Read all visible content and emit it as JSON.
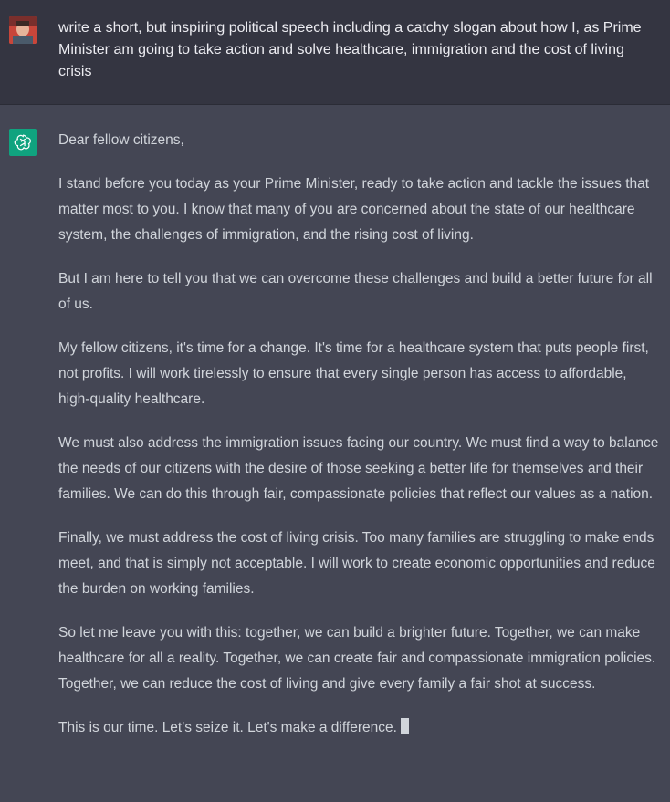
{
  "user_message": {
    "avatar_icon": "user-photo-icon",
    "text": "write a short, but inspiring political speech including a catchy slogan about how I, as Prime Minister am going to take action and solve healthcare, immigration and the cost of living crisis"
  },
  "assistant_message": {
    "avatar_icon": "openai-logo-icon",
    "paragraphs": [
      "Dear fellow citizens,",
      "I stand before you today as your Prime Minister, ready to take action and tackle the issues that matter most to you. I know that many of you are concerned about the state of our healthcare system, the challenges of immigration, and the rising cost of living.",
      "But I am here to tell you that we can overcome these challenges and build a better future for all of us.",
      "My fellow citizens, it's time for a change. It's time for a healthcare system that puts people first, not profits. I will work tirelessly to ensure that every single person has access to affordable, high-quality healthcare.",
      "We must also address the immigration issues facing our country. We must find a way to balance the needs of our citizens with the desire of those seeking a better life for themselves and their families. We can do this through fair, compassionate policies that reflect our values as a nation.",
      "Finally, we must address the cost of living crisis. Too many families are struggling to make ends meet, and that is simply not acceptable. I will work to create economic opportunities and reduce the burden on working families.",
      "So let me leave you with this: together, we can build a brighter future. Together, we can make healthcare for all a reality. Together, we can create fair and compassionate immigration policies. Together, we can reduce the cost of living and give every family a fair shot at success.",
      "This is our time. Let's seize it. Let's make a difference."
    ]
  },
  "colors": {
    "user_background": "#343541",
    "assistant_background": "#444654",
    "text": "#d1d5db",
    "brand_green": "#10a37f"
  }
}
